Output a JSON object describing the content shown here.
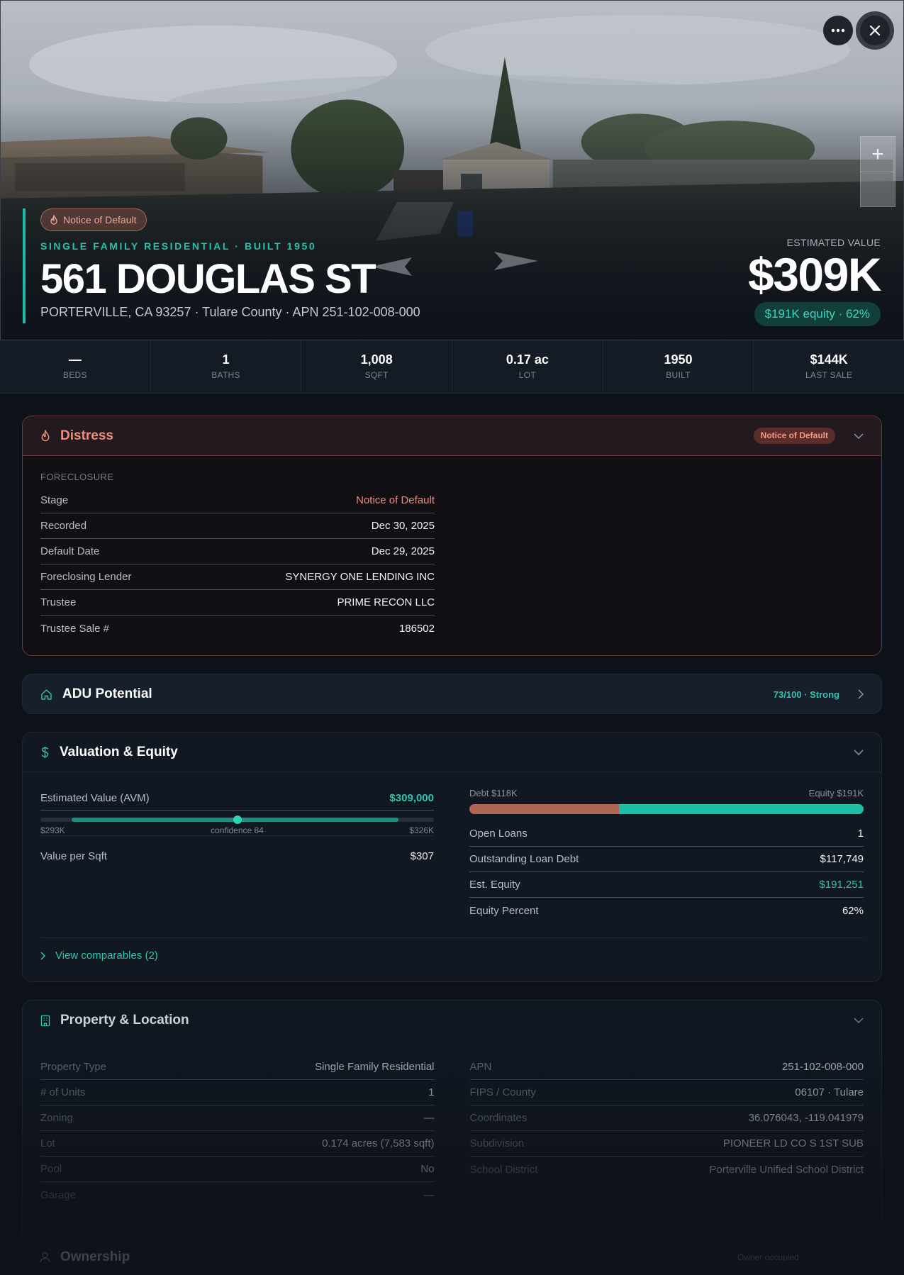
{
  "hero": {
    "status_pill": "Notice of Default",
    "kicker": "SINGLE FAMILY RESIDENTIAL · BUILT 1950",
    "address": "561 DOUGLAS ST",
    "subline": "PORTERVILLE, CA 93257 · Tulare County · APN 251-102-008-000",
    "estimated_label": "ESTIMATED VALUE",
    "estimated_value": "$309K",
    "equity_pill": "$191K equity · 62%",
    "zoom_in": "+",
    "zoom_out": "−"
  },
  "stats": [
    {
      "value": "—",
      "label": "BEDS"
    },
    {
      "value": "1",
      "label": "BATHS"
    },
    {
      "value": "1,008",
      "label": "SQFT"
    },
    {
      "value": "0.17 ac",
      "label": "LOT"
    },
    {
      "value": "1950",
      "label": "BUILT"
    },
    {
      "value": "$144K",
      "label": "LAST SALE"
    }
  ],
  "distress": {
    "title": "Distress",
    "badge": "Notice of Default",
    "section": "FORECLOSURE",
    "rows": [
      {
        "k": "Stage",
        "v": "Notice of Default"
      },
      {
        "k": "Recorded",
        "v": "Dec 30, 2025"
      },
      {
        "k": "Default Date",
        "v": "Dec 29, 2025"
      },
      {
        "k": "Foreclosing Lender",
        "v": "SYNERGY ONE LENDING INC"
      },
      {
        "k": "Trustee",
        "v": "PRIME RECON LLC"
      },
      {
        "k": "Trustee Sale #",
        "v": "186502"
      }
    ]
  },
  "adu": {
    "title": "ADU Potential",
    "score": "73/100 · Strong"
  },
  "valuation": {
    "title": "Valuation & Equity",
    "avm_label": "Estimated Value (AVM)",
    "avm_value": "$309,000",
    "range_low": "$293K",
    "range_high": "$326K",
    "confidence": "confidence 84",
    "range_fill_start": 0.08,
    "range_fill_end": 0.91,
    "range_point": 0.5,
    "vps_label": "Value per Sqft",
    "vps_value": "$307",
    "debt_label": "Debt $118K",
    "equity_label": "Equity $191K",
    "debt_fraction": 0.38,
    "rows": [
      {
        "k": "Open Loans",
        "v": "1"
      },
      {
        "k": "Outstanding Loan Debt",
        "v": "$117,749"
      },
      {
        "k": "Est. Equity",
        "v": "$191,251"
      },
      {
        "k": "Equity Percent",
        "v": "62%"
      }
    ],
    "comparables_link": "View comparables (2)"
  },
  "property": {
    "title": "Property & Location",
    "left_rows": [
      {
        "k": "Property Type",
        "v": "Single Family Residential"
      },
      {
        "k": "# of Units",
        "v": "1"
      },
      {
        "k": "Zoning",
        "v": "—"
      },
      {
        "k": "Lot",
        "v": "0.174 acres (7,583 sqft)"
      },
      {
        "k": "Pool",
        "v": "No"
      },
      {
        "k": "Garage",
        "v": "—"
      }
    ],
    "right_rows": [
      {
        "k": "APN",
        "v": "251-102-008-000"
      },
      {
        "k": "FIPS / County",
        "v": "06107 · Tulare"
      },
      {
        "k": "Coordinates",
        "v": "36.076043, -119.041979"
      },
      {
        "k": "Subdivision",
        "v": "PIONEER LD CO S 1ST SUB"
      },
      {
        "k": "School District",
        "v": "Porterville Unified School District"
      }
    ]
  },
  "ownership": {
    "title": "Ownership",
    "badge": "Owner occupied"
  },
  "colors": {
    "accent_teal": "#22b8a3",
    "distress_coral": "#ef8c77",
    "debt_bar": "#b06656",
    "equity_bar": "#1fbfa5"
  }
}
